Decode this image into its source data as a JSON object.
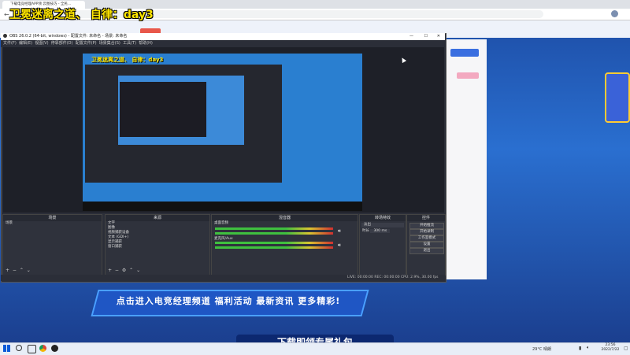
{
  "browser": {
    "tab_title": "下载电竞经理APP领 云图技巧 - 全民…",
    "close_icon": "close-icon"
  },
  "overlay": {
    "title": "卫冕迷离之道、 自律：day3"
  },
  "obs": {
    "window_title": "OBS 26.0.2 (64-bit, windows) - 配置文件: 未命名 - 场景: 未命名",
    "menu": [
      "文件(F)",
      "编辑(E)",
      "视图(V)",
      "停靠部件(D)",
      "配置文件(P)",
      "场景集合(S)",
      "工具(T)",
      "帮助(H)"
    ],
    "docks": {
      "scenes": {
        "title": "场景",
        "items": [
          "场景"
        ]
      },
      "sources": {
        "title": "来源",
        "items": [
          "文字",
          "图像",
          "视频捕获设备",
          "文本 (GDI+)",
          "显示捕获",
          "窗口捕获"
        ]
      },
      "mixer": {
        "title": "混音器",
        "tracks": [
          "桌面音频",
          "麦克风/Aux"
        ]
      },
      "transitions": {
        "title": "转场特效",
        "type": "淡出",
        "duration_label": "时长",
        "duration": "300 ms"
      },
      "controls": {
        "title": "控件",
        "buttons": [
          "开始推流",
          "开始录制",
          "工作室模式",
          "设置",
          "退出"
        ]
      }
    },
    "status": "LIVE: 00:00:00   REC: 00:00:00   CPU: 2.9%, 30.00 fps"
  },
  "webpage": {
    "promo_text": "点击进入电竞经理频道 福利活动 最新资讯 更多精彩!",
    "download_text": "下载即领专属礼包"
  },
  "taskbar": {
    "weather": "29°C 晴朗",
    "time": "23:56",
    "date": "2022/7/22"
  }
}
